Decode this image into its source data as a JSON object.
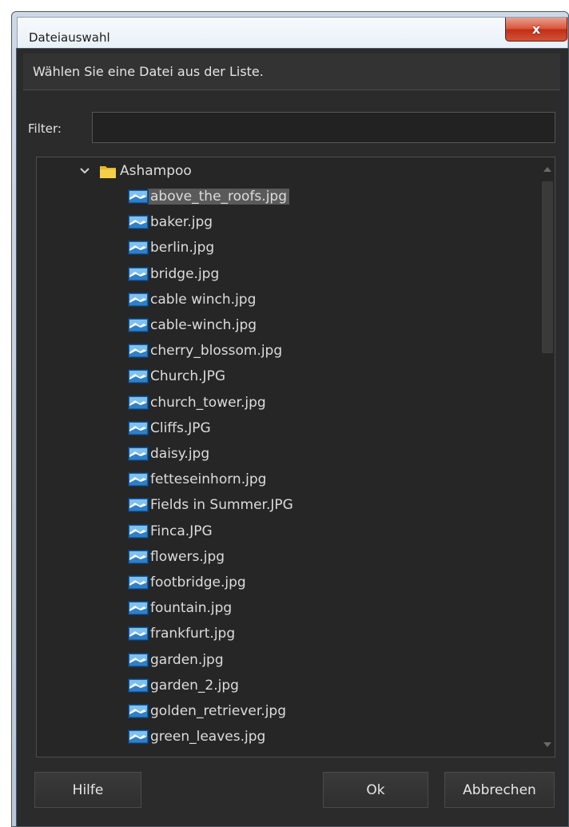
{
  "window": {
    "title": "Dateiauswahl",
    "close_label": "x"
  },
  "header": {
    "instruction": "Wählen Sie eine Datei aus der Liste."
  },
  "filter": {
    "label": "Filter:",
    "value": ""
  },
  "tree": {
    "folder": {
      "name": "Ashampoo",
      "expanded": true,
      "icon": "folder-icon"
    },
    "selected_file": "above_the_roofs.jpg",
    "files": [
      "above_the_roofs.jpg",
      "baker.jpg",
      "berlin.jpg",
      "bridge.jpg",
      "cable winch.jpg",
      "cable-winch.jpg",
      "cherry_blossom.jpg",
      "Church.JPG",
      "church_tower.jpg",
      "Cliffs.JPG",
      "daisy.jpg",
      "fetteseinhorn.jpg",
      "Fields in Summer.JPG",
      "Finca.JPG",
      "flowers.jpg",
      "footbridge.jpg",
      "fountain.jpg",
      "frankfurt.jpg",
      "garden.jpg",
      "garden_2.jpg",
      "golden_retriever.jpg",
      "green_leaves.jpg"
    ]
  },
  "buttons": {
    "help": "Hilfe",
    "ok": "Ok",
    "cancel": "Abbrechen"
  },
  "colors": {
    "dialog_background": "#2b2b2b",
    "list_background": "#262626",
    "selection": "#5a5a5a",
    "text": "#dcdcdc",
    "close_button": "#c9452c"
  }
}
